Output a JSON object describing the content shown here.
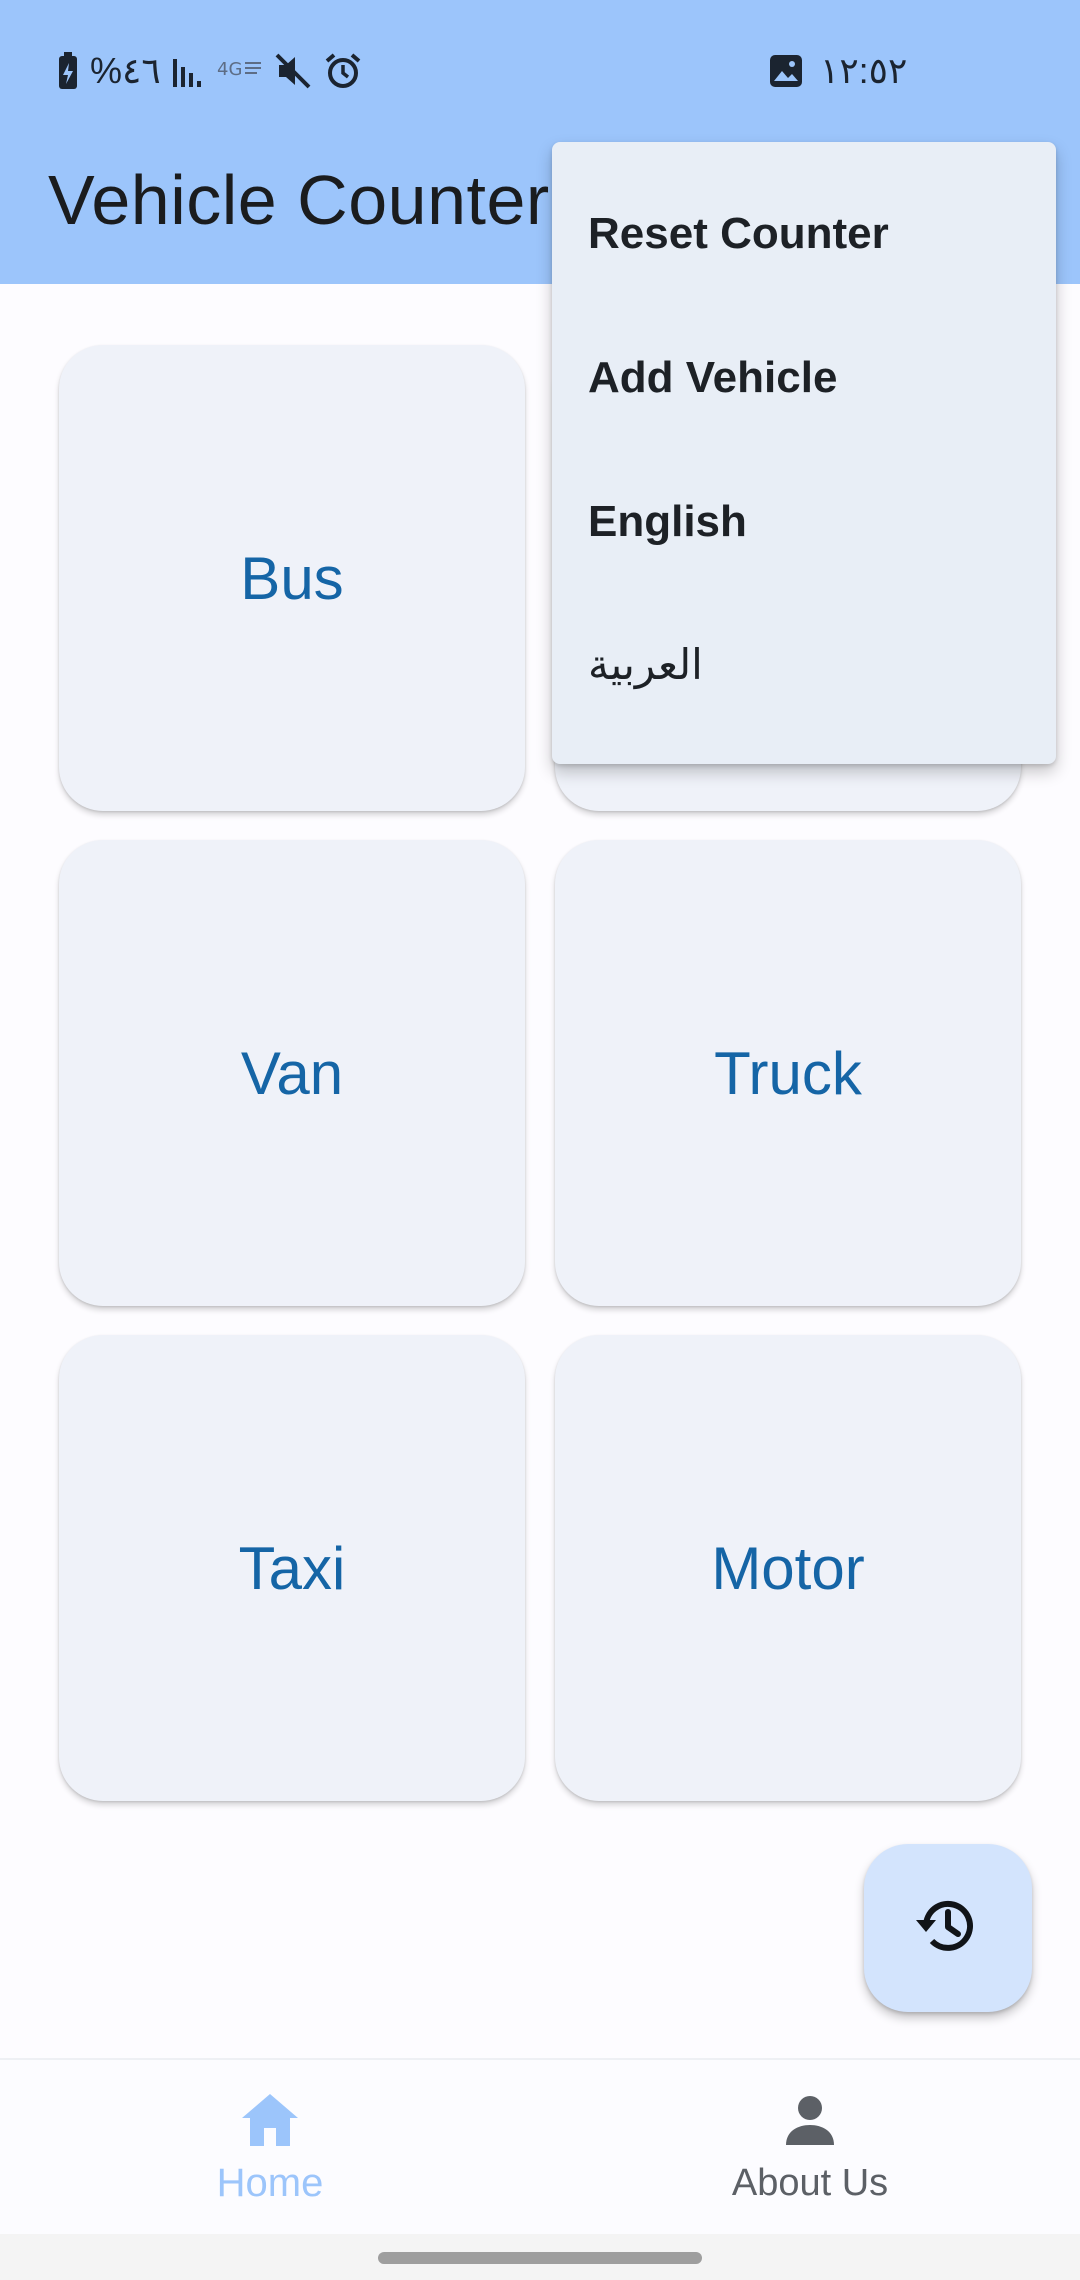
{
  "status_bar": {
    "battery_percent": "%٤٦",
    "time": "١٢:٥٢"
  },
  "app_bar": {
    "title": "Vehicle Counter"
  },
  "vehicles": [
    {
      "label": "Bus"
    },
    {
      "label": ""
    },
    {
      "label": "Van"
    },
    {
      "label": "Truck"
    },
    {
      "label": "Taxi"
    },
    {
      "label": "Motor"
    }
  ],
  "menu": {
    "items": [
      {
        "label": "Reset Counter"
      },
      {
        "label": "Add Vehicle"
      },
      {
        "label": "English"
      },
      {
        "label": "العربية"
      }
    ]
  },
  "fab": {
    "icon": "history-icon"
  },
  "bottom_nav": {
    "items": [
      {
        "label": "Home",
        "icon": "home-icon",
        "active": true
      },
      {
        "label": "About Us",
        "icon": "person-icon",
        "active": false
      }
    ]
  },
  "colors": {
    "app_bar": "#9cc5fb",
    "card": "#eff2f9",
    "card_text": "#1565a6",
    "menu": "#e8eef6",
    "fab": "#d3e4fd",
    "nav_active": "#9cc5fb"
  }
}
